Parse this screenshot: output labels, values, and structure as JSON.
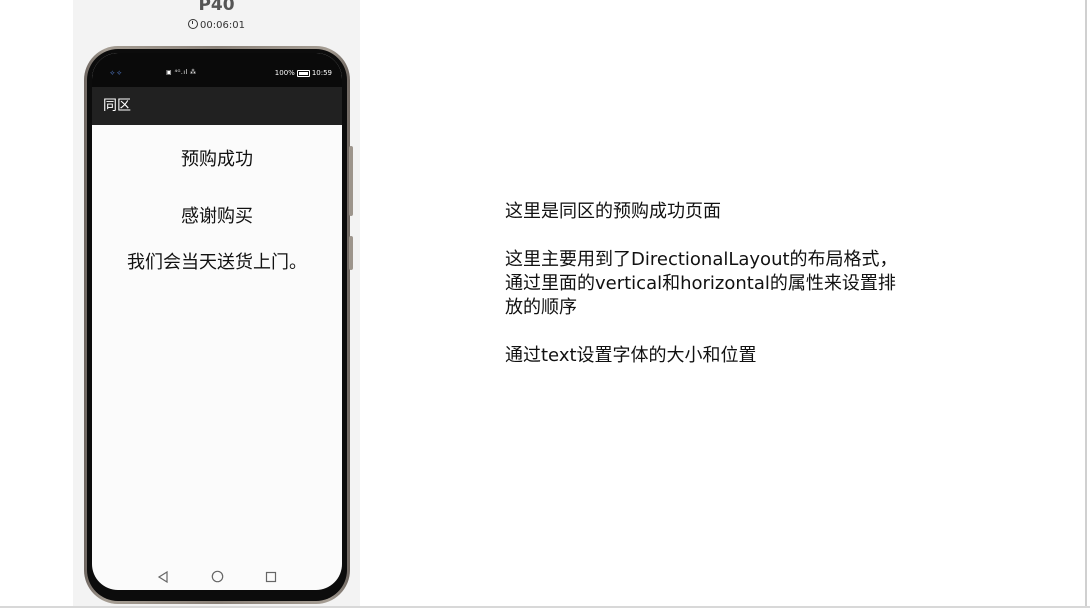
{
  "simulator": {
    "device_name": "P40",
    "timer": "00:06:01"
  },
  "status_bar": {
    "left_icons": "⟡  ⟡",
    "signal": "▣ ⁴ᴳ.ıl ⁂",
    "battery_text": "100%",
    "time": "10:59"
  },
  "app": {
    "title": "同区",
    "lines": [
      "预购成功",
      "感谢购买",
      "我们会当天送货上门。"
    ]
  },
  "nav": {
    "back_icon": "back-triangle-icon",
    "home_icon": "home-circle-icon",
    "recent_icon": "recent-square-icon"
  },
  "description": {
    "line1": "这里是同区的预购成功页面",
    "line2a": "这里主要用到了DirectionalLayout的布局格式，",
    "line2b": "通过里面的vertical和horizontal的属性来设置排",
    "line2c": "放的顺序",
    "line3": "通过text设置字体的大小和位置"
  },
  "colors": {
    "app_bar": "#212121",
    "status_bar": "#0a0a0a",
    "screen_bg": "#fbfbfb",
    "panel_bg": "#f3f3f3"
  }
}
